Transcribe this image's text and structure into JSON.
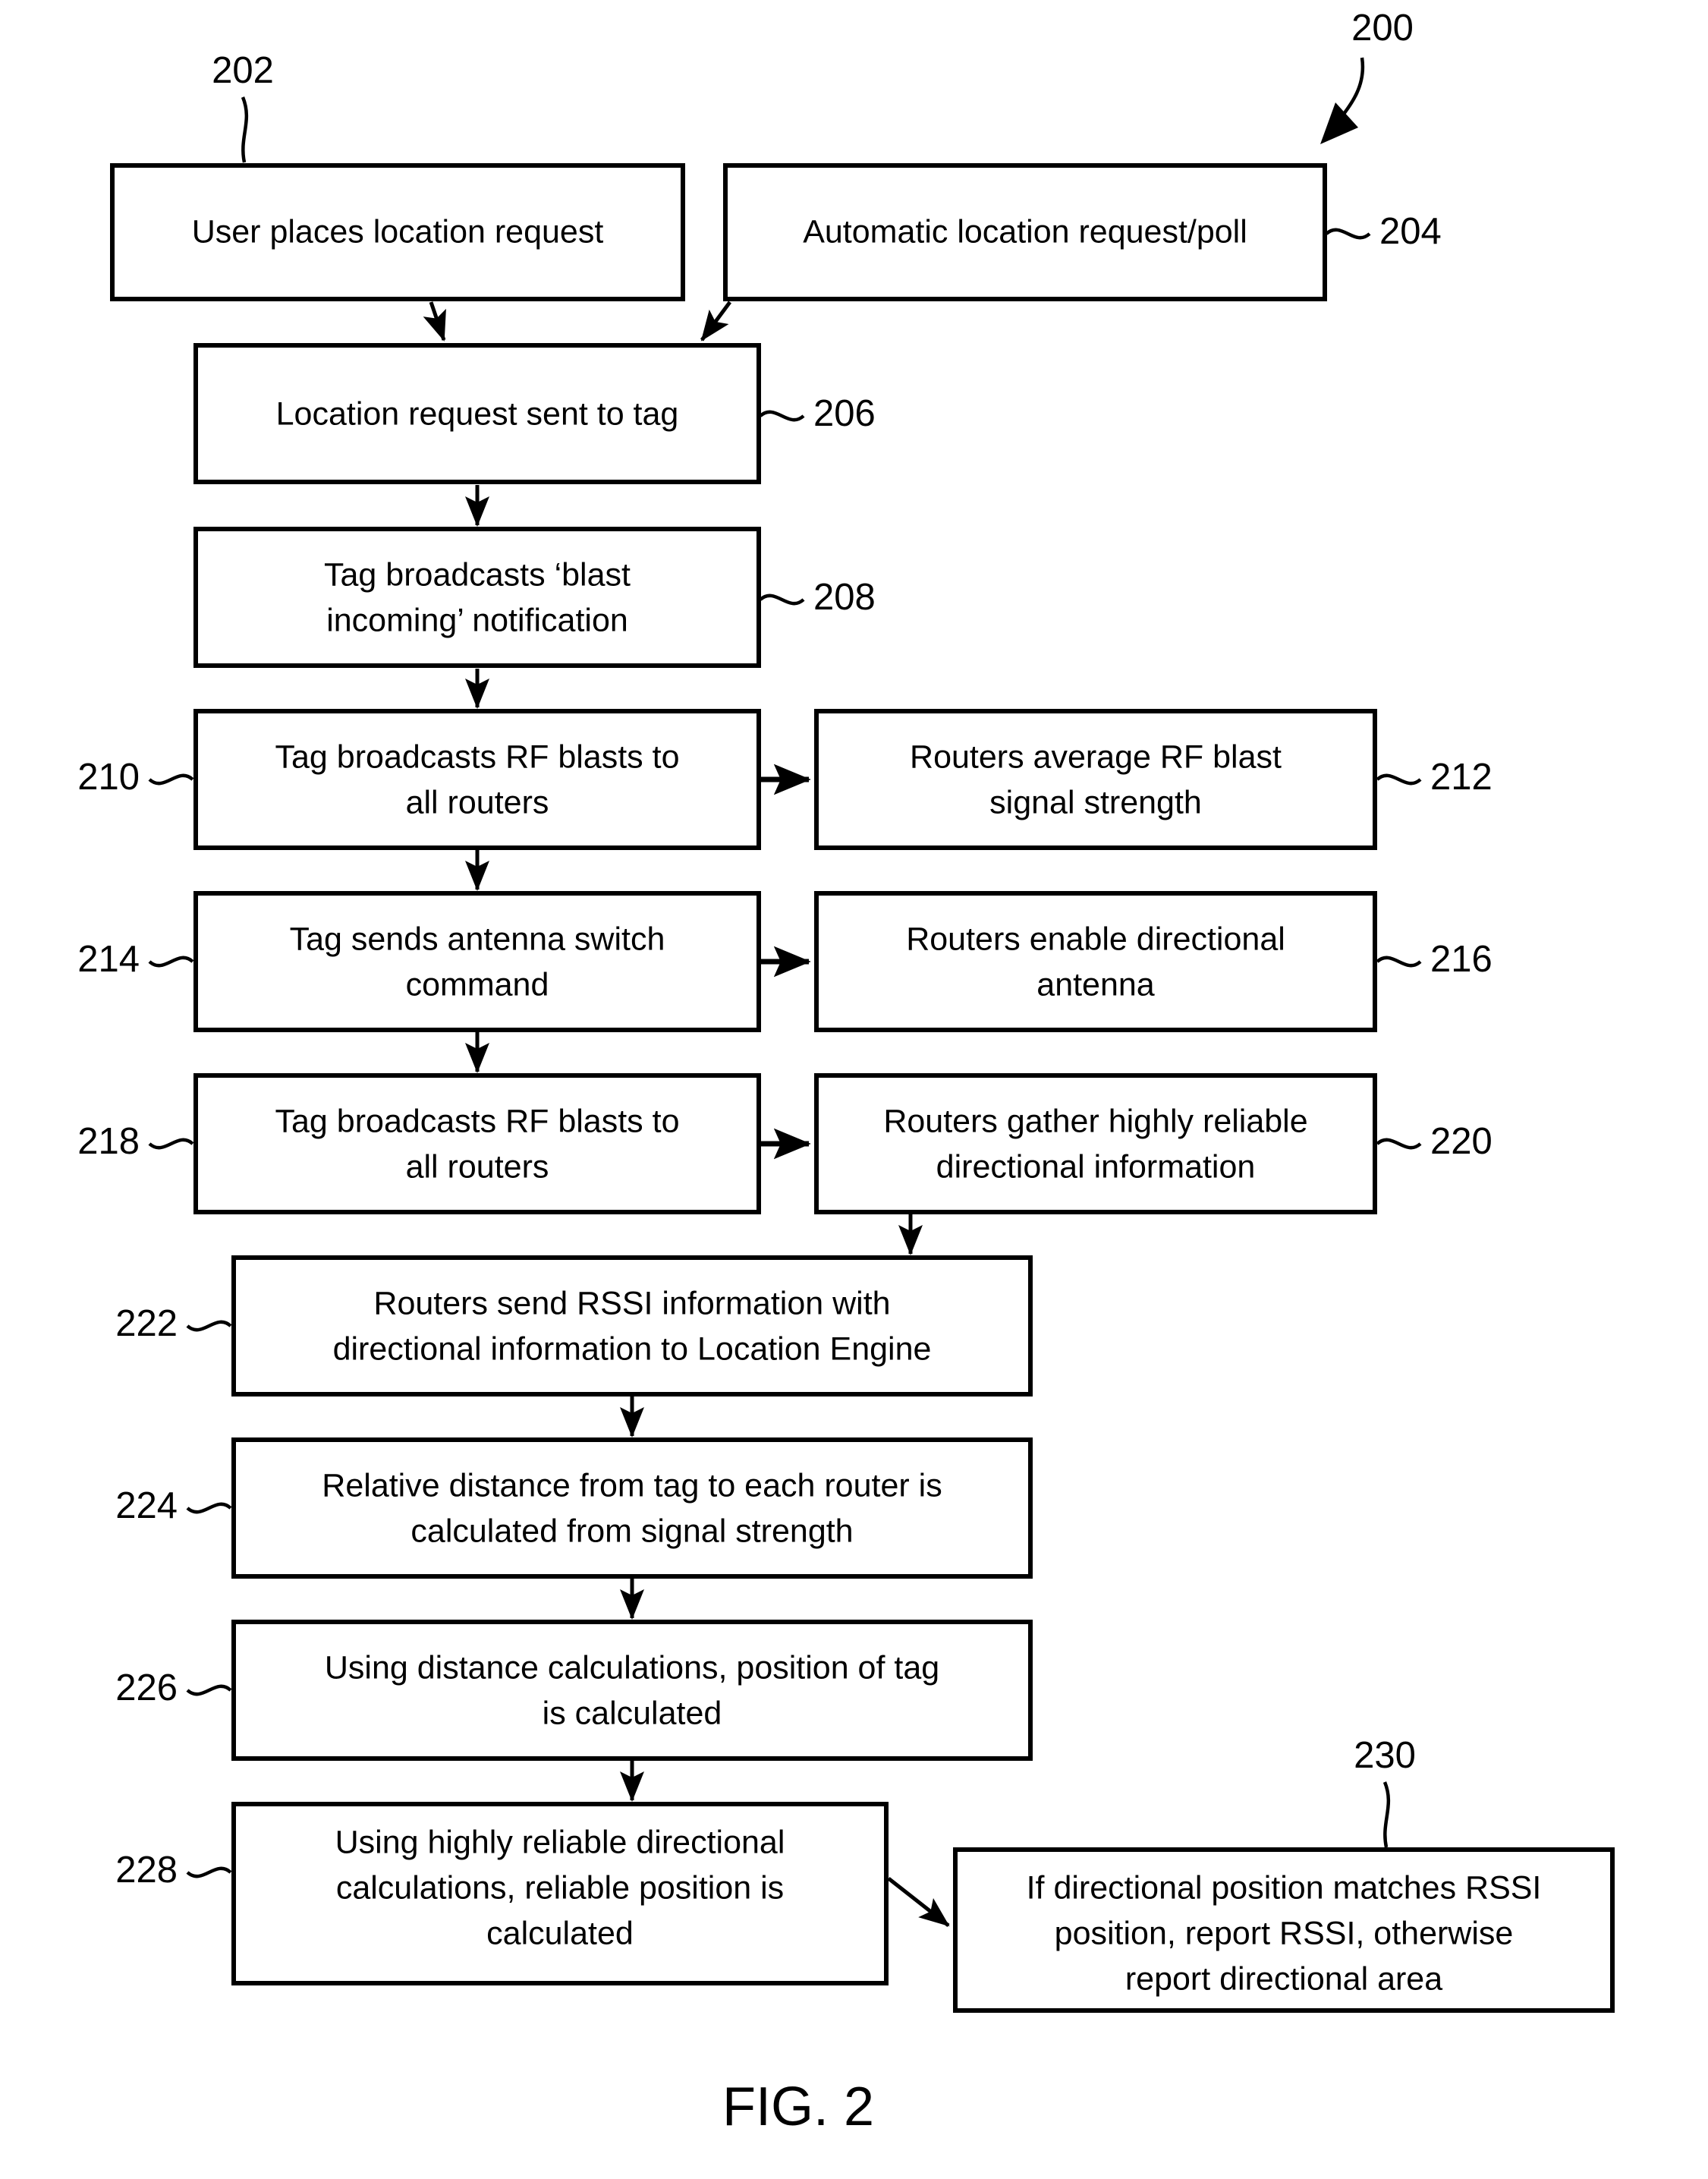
{
  "figure": {
    "caption": "FIG. 2",
    "diagram_ref": "200"
  },
  "nodes": [
    {
      "ref": "202",
      "lines": [
        "User places location request"
      ],
      "ref_side": "top"
    },
    {
      "ref": "204",
      "lines": [
        "Automatic location request/poll"
      ],
      "ref_side": "right"
    },
    {
      "ref": "206",
      "lines": [
        "Location request sent to tag"
      ],
      "ref_side": "right"
    },
    {
      "ref": "208",
      "lines": [
        "Tag broadcasts ‘blast",
        "incoming’ notification"
      ],
      "ref_side": "right"
    },
    {
      "ref": "210",
      "lines": [
        "Tag broadcasts RF blasts to",
        "all routers"
      ],
      "ref_side": "left"
    },
    {
      "ref": "212",
      "lines": [
        "Routers average RF blast",
        "signal strength"
      ],
      "ref_side": "right"
    },
    {
      "ref": "214",
      "lines": [
        "Tag sends antenna switch",
        "command"
      ],
      "ref_side": "left"
    },
    {
      "ref": "216",
      "lines": [
        "Routers enable directional",
        "antenna"
      ],
      "ref_side": "right"
    },
    {
      "ref": "218",
      "lines": [
        "Tag broadcasts RF blasts to",
        "all routers"
      ],
      "ref_side": "left"
    },
    {
      "ref": "220",
      "lines": [
        "Routers gather highly reliable",
        "directional information"
      ],
      "ref_side": "right"
    },
    {
      "ref": "222",
      "lines": [
        "Routers send RSSI information with",
        "directional information to Location Engine"
      ],
      "ref_side": "left"
    },
    {
      "ref": "224",
      "lines": [
        "Relative distance from tag to each router is",
        "calculated from signal strength"
      ],
      "ref_side": "left"
    },
    {
      "ref": "226",
      "lines": [
        "Using distance calculations, position of tag",
        "is calculated"
      ],
      "ref_side": "left"
    },
    {
      "ref": "228",
      "lines": [
        "Using highly reliable directional",
        "calculations, reliable position is",
        "calculated"
      ],
      "ref_side": "left"
    },
    {
      "ref": "230",
      "lines": [
        "If directional position matches RSSI",
        "position, report RSSI, otherwise",
        "report directional area"
      ],
      "ref_side": "top"
    }
  ],
  "colors": {
    "stroke": "#000000",
    "fill": "#ffffff",
    "text": "#000000"
  }
}
